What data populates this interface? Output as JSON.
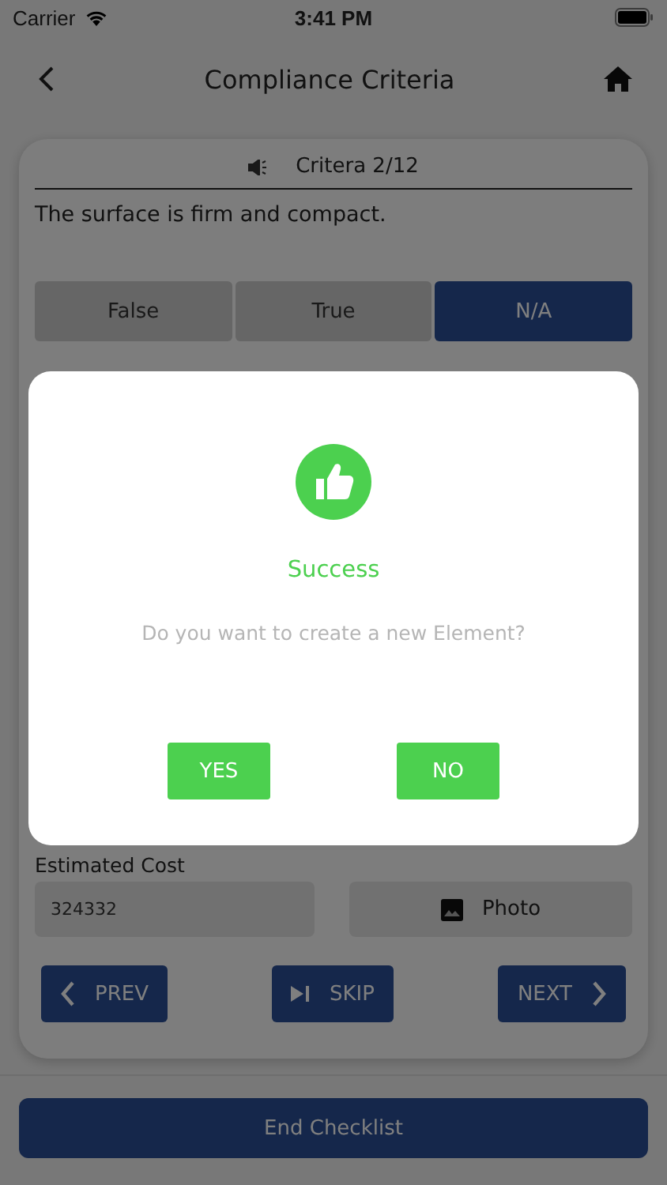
{
  "status_bar": {
    "carrier": "Carrier",
    "time": "3:41 PM"
  },
  "nav": {
    "title": "Compliance Criteria"
  },
  "criteria": {
    "label": "Critera 2/12",
    "statement": "The surface is firm and compact."
  },
  "answers": [
    {
      "label": "False",
      "selected": false
    },
    {
      "label": "True",
      "selected": false
    },
    {
      "label": "N/A",
      "selected": true
    }
  ],
  "estimated_cost": {
    "label": "Estimated Cost",
    "value": "324332"
  },
  "photo_button": {
    "label": "Photo"
  },
  "step_buttons": [
    {
      "kind": "prev",
      "label": "PREV"
    },
    {
      "kind": "skip",
      "label": "SKIP"
    },
    {
      "kind": "next",
      "label": "NEXT"
    }
  ],
  "end_button": {
    "label": "End Checklist"
  },
  "dialog": {
    "title": "Success",
    "message": "Do you want to create a new Element?",
    "buttons": [
      "YES",
      "NO"
    ]
  }
}
